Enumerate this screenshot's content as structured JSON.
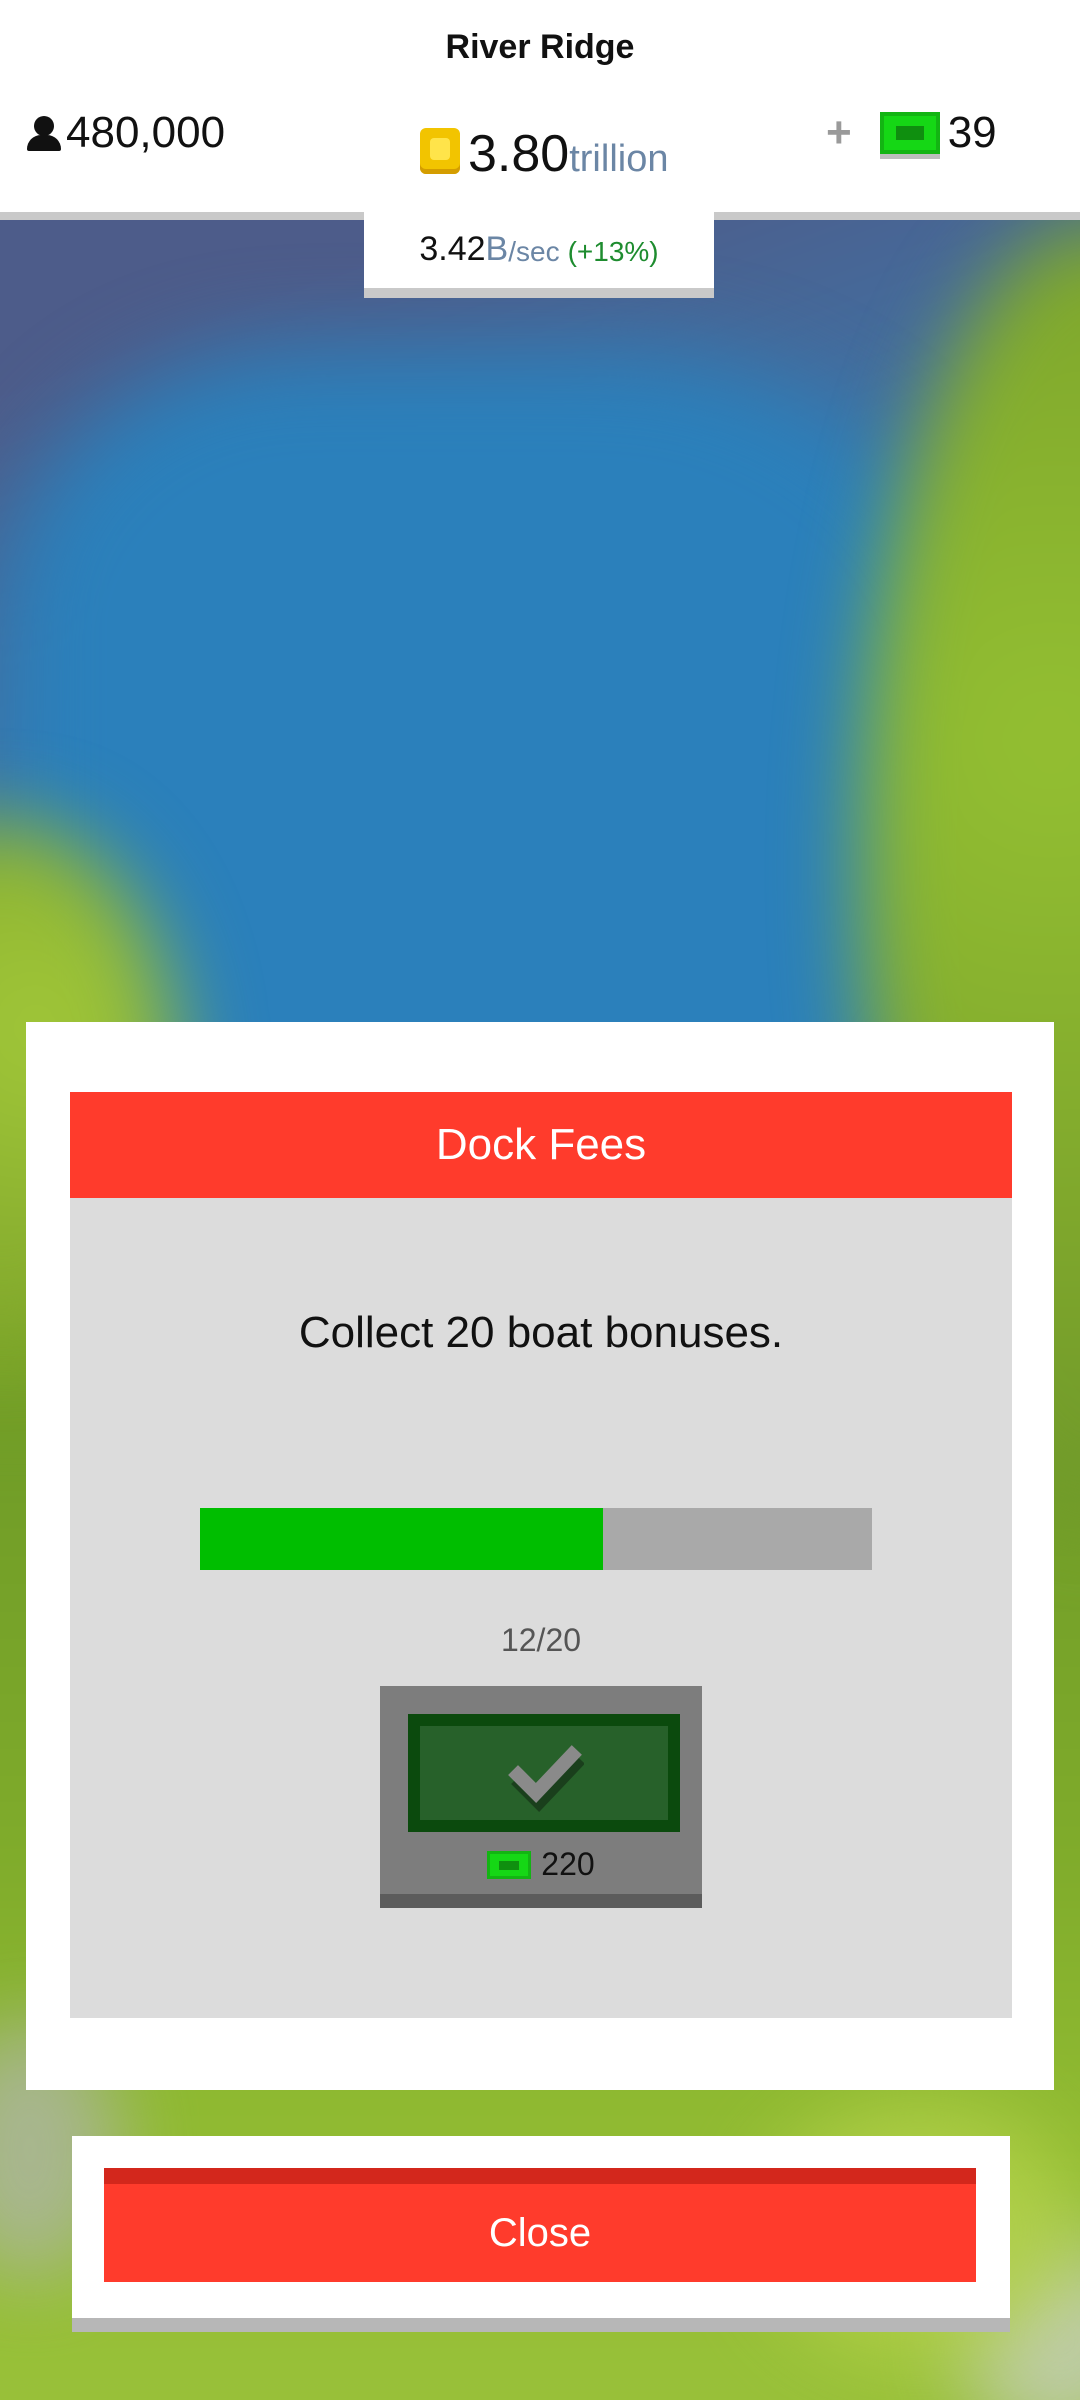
{
  "header": {
    "city_name": "River Ridge",
    "population": "480,000",
    "coins": {
      "value": "3.80",
      "unit": "trillion"
    },
    "income": {
      "value": "3.42",
      "unit": "B",
      "per": "/sec",
      "bonus": "(+13%)"
    },
    "cash": "39",
    "add_icon": "plus-icon"
  },
  "mission": {
    "title": "Dock Fees",
    "description": "Collect 20 boat bonuses.",
    "progress_text": "12/20",
    "progress_fraction": 0.6,
    "reward": "220",
    "claim_icon": "checkmark-icon"
  },
  "close_label": "Close",
  "colors": {
    "accent_red": "#ff3b2c",
    "progress_green": "#00be00",
    "cash_green": "#15d715",
    "coin_gold": "#f2c400"
  }
}
